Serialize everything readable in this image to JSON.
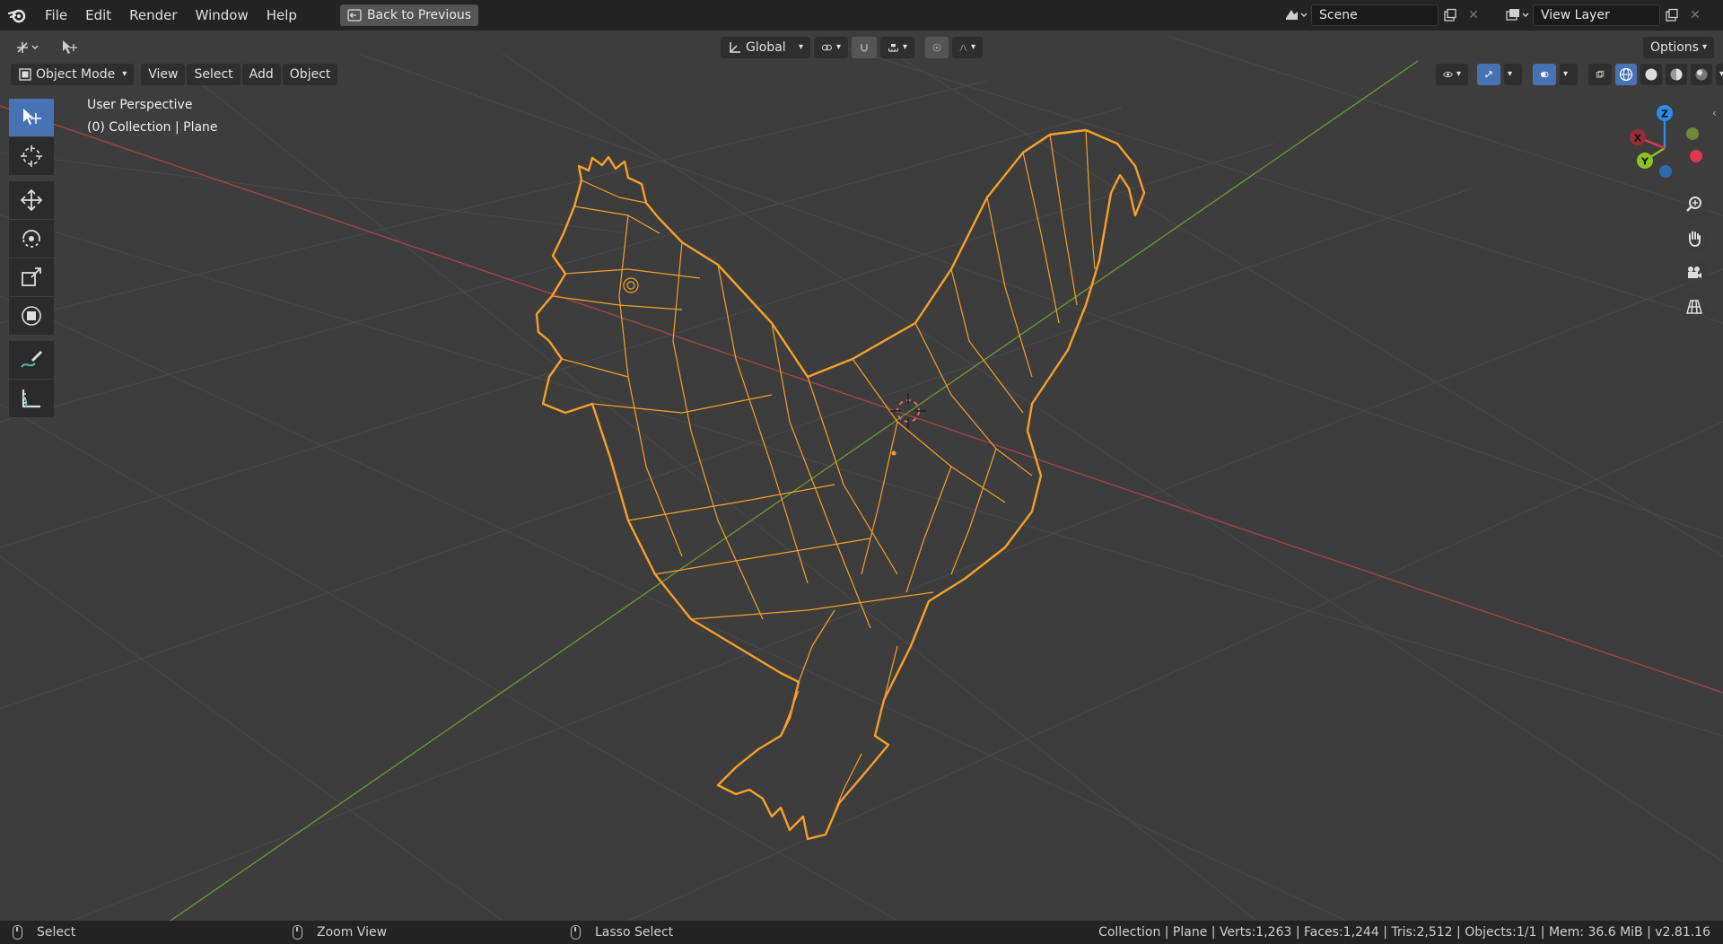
{
  "topbar": {
    "menus": [
      "File",
      "Edit",
      "Render",
      "Window",
      "Help"
    ],
    "back_label": "Back to Previous",
    "scene_value": "Scene",
    "view_layer_value": "View Layer"
  },
  "tool_header": {
    "orientation": "Global",
    "options_label": "Options"
  },
  "viewport_header": {
    "mode": "Object Mode",
    "menus": [
      "View",
      "Select",
      "Add",
      "Object"
    ]
  },
  "overlay": {
    "perspective": "User Perspective",
    "collection": "(0) Collection | Plane"
  },
  "gizmo": {
    "z": "Z",
    "x": "X",
    "y": "Y"
  },
  "statusbar": {
    "select": "Select",
    "zoom": "Zoom View",
    "lasso": "Lasso Select",
    "stats": "Collection | Plane | Verts:1,263 | Faces:1,244 | Tris:2,512 | Objects:1/1 | Mem: 36.6 MiB | v2.81.16"
  },
  "colors": {
    "accent": "#4772b3",
    "selection": "#f5a02a",
    "x_axis": "#c94a4a",
    "y_axis": "#6d9a2a",
    "gizmo_z": "#2d8ceb",
    "gizmo_y": "#8cc21f",
    "gizmo_x": "#e0364f"
  },
  "icons": [
    "blender-logo-icon",
    "editor-type-icon",
    "select-box-icon",
    "cursor-icon",
    "move-icon",
    "rotate-icon",
    "scale-icon",
    "transform-icon",
    "annotate-icon",
    "measure-icon",
    "zoom-icon",
    "hand-icon",
    "camera-icon",
    "grid-icon"
  ]
}
